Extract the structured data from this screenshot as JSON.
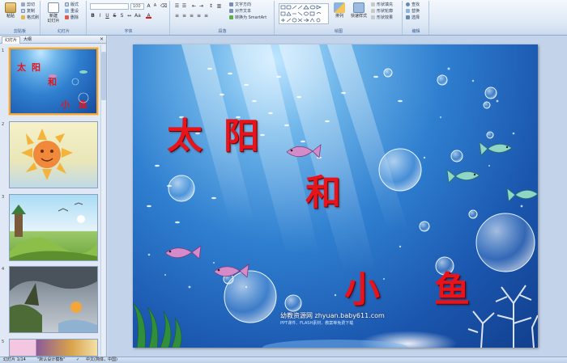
{
  "ribbon": {
    "clipboard": {
      "label": "剪贴板",
      "paste": "粘贴",
      "cut": "剪切",
      "copy": "复制",
      "format_painter": "格式刷"
    },
    "slides": {
      "label": "幻灯片",
      "new_slide": "新建\n幻灯片",
      "layout": "版式",
      "reset": "重设",
      "delete": "删除"
    },
    "font": {
      "label": "字体",
      "font_name": "",
      "font_size": "100"
    },
    "paragraph": {
      "label": "段落",
      "text_direction": "文字方向",
      "align_text": "对齐文本",
      "smartart": "转换为 SmartArt"
    },
    "drawing": {
      "label": "绘图",
      "arrange": "排列",
      "quick_styles": "快速样式",
      "shape_fill": "形状填充",
      "shape_outline": "形状轮廓",
      "shape_effects": "形状效果"
    },
    "editing": {
      "label": "编辑",
      "find": "查找",
      "replace": "替换",
      "select": "选择"
    }
  },
  "pane": {
    "tab_slides": "幻灯片",
    "tab_outline": "大纲",
    "close": "×",
    "slides": [
      {
        "num": "1"
      },
      {
        "num": "2"
      },
      {
        "num": "3"
      },
      {
        "num": "4"
      },
      {
        "num": "5"
      }
    ]
  },
  "slide": {
    "title_chars": [
      "太",
      "阳",
      "和",
      "小",
      "鱼"
    ],
    "watermark": "幼教资源网 zhyuan.baby611.com",
    "watermark_sub": "PPT课件、FLASH素材、教案等免费下载"
  },
  "thumb1": {
    "chars": [
      "太",
      "阳",
      "和",
      "小",
      "鱼"
    ]
  },
  "status": {
    "slide_counter": "幻灯片 1/14",
    "theme": "\"默认设计模板\"",
    "language": "中文(简体，中国)"
  },
  "colors": {
    "title_red": "#e8141b",
    "ocean_blue": "#2f7fd0",
    "selection_orange": "#f1a33a",
    "ribbon_bg": "#dde8f5"
  }
}
